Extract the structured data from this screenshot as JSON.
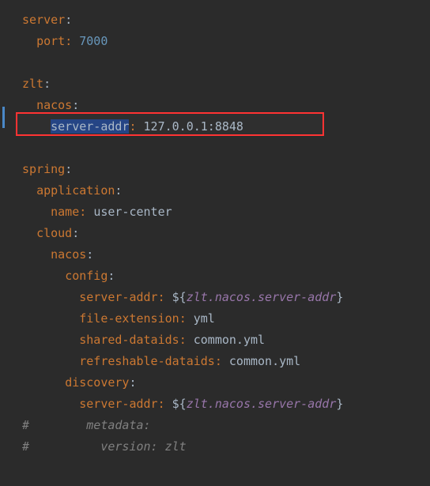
{
  "code": {
    "l1": {
      "key": "server",
      "colon": ":"
    },
    "l2": {
      "indent": "  ",
      "key": "port",
      "colon": ": ",
      "value": "7000"
    },
    "l3": "",
    "l4": {
      "key": "zlt",
      "colon": ":"
    },
    "l5": {
      "indent": "  ",
      "key": "nacos",
      "colon": ":"
    },
    "l6": {
      "indent": "    ",
      "key": "server-addr",
      "colon": ": ",
      "value": "127.0.0.1:8848"
    },
    "l7": "",
    "l8": {
      "key": "spring",
      "colon": ":"
    },
    "l9": {
      "indent": "  ",
      "key": "application",
      "colon": ":"
    },
    "l10": {
      "indent": "    ",
      "key": "name",
      "colon": ": ",
      "value": "user-center"
    },
    "l11": {
      "indent": "  ",
      "key": "cloud",
      "colon": ":"
    },
    "l12": {
      "indent": "    ",
      "key": "nacos",
      "colon": ":"
    },
    "l13": {
      "indent": "      ",
      "key": "config",
      "colon": ":"
    },
    "l14": {
      "indent": "        ",
      "key": "server-addr",
      "colon": ": ",
      "prefix": "${",
      "var": "zlt.nacos.server-addr",
      "suffix": "}"
    },
    "l15": {
      "indent": "        ",
      "key": "file-extension",
      "colon": ": ",
      "value": "yml"
    },
    "l16": {
      "indent": "        ",
      "key": "shared-dataids",
      "colon": ": ",
      "value": "common.yml"
    },
    "l17": {
      "indent": "        ",
      "key": "refreshable-dataids",
      "colon": ": ",
      "value": "common.yml"
    },
    "l18": {
      "indent": "      ",
      "key": "discovery",
      "colon": ":"
    },
    "l19": {
      "indent": "        ",
      "key": "server-addr",
      "colon": ": ",
      "prefix": "${",
      "var": "zlt.nacos.server-addr",
      "suffix": "}"
    },
    "l20": {
      "indent": "#        ",
      "text": "metadata:"
    },
    "l21": {
      "indent": "#          ",
      "text": "version: zlt"
    }
  },
  "highlight": {
    "line": 6
  }
}
